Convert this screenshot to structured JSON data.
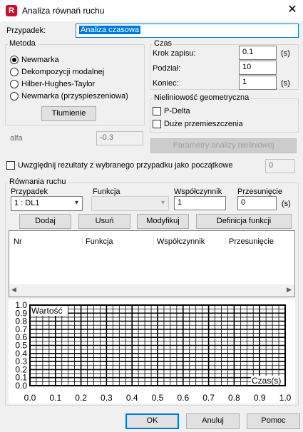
{
  "window": {
    "title": "Analiza równań ruchu",
    "app_icon_letter": "R"
  },
  "case_field": {
    "label": "Przypadek:",
    "value": "Analiza czasowa"
  },
  "method": {
    "group_title": "Metoda",
    "options": [
      "Newmarka",
      "Dekompozycji modalnej",
      "Hilber-Hughes-Taylor",
      "Newmarka (przyspieszeniowa)"
    ],
    "selected_index": 0,
    "damping_button": "Tłumienie",
    "alfa_label": "alfa",
    "alfa_value": "-0.3"
  },
  "time": {
    "group_title": "Czas",
    "step_label": "Krok zapisu:",
    "step_value": "0.1",
    "step_unit": "(s)",
    "division_label": "Podział:",
    "division_value": "10",
    "end_label": "Koniec:",
    "end_value": "1",
    "end_unit": "(s)"
  },
  "nonlinearity": {
    "group_title": "Nieliniowość geometryczna",
    "pdelta_label": "P-Delta",
    "large_disp_label": "Duże przemieszczenia",
    "params_button": "Parametry analizy nieliniowej"
  },
  "initial_results": {
    "label": "Uwzględnij rezultaty z wybranego przypadku jako początkowe",
    "value": "0"
  },
  "equations": {
    "group_title": "Równania ruchu",
    "case_label": "Przypadek",
    "case_value": "1 : DL1",
    "function_label": "Funkcja",
    "function_value": "",
    "coef_label": "Współczynnik",
    "coef_value": "1",
    "shift_label": "Przesunięcie",
    "shift_value": "0",
    "shift_unit": "(s)",
    "buttons": {
      "add": "Dodaj",
      "remove": "Usuń",
      "modify": "Modyfikuj",
      "define": "Definicja funkcji"
    },
    "columns": [
      "Nr",
      "Funkcja",
      "Współczynnik",
      "Przesunięcie"
    ]
  },
  "chart_data": {
    "type": "line",
    "title": "",
    "xlabel": "Czas(s)",
    "ylabel": "Wartość",
    "xlim": [
      0,
      1
    ],
    "ylim": [
      0,
      1
    ],
    "x_ticks": [
      "0.0",
      "0.1",
      "0.2",
      "0.3",
      "0.4",
      "0.5",
      "0.6",
      "0.7",
      "0.8",
      "0.9",
      "1.0"
    ],
    "y_ticks": [
      "0.0",
      "0.1",
      "0.2",
      "0.3",
      "0.4",
      "0.5",
      "0.6",
      "0.7",
      "0.8",
      "0.9",
      "1.0"
    ],
    "grid": true,
    "series": []
  },
  "footer": {
    "ok": "OK",
    "cancel": "Anuluj",
    "help": "Pomoc"
  }
}
